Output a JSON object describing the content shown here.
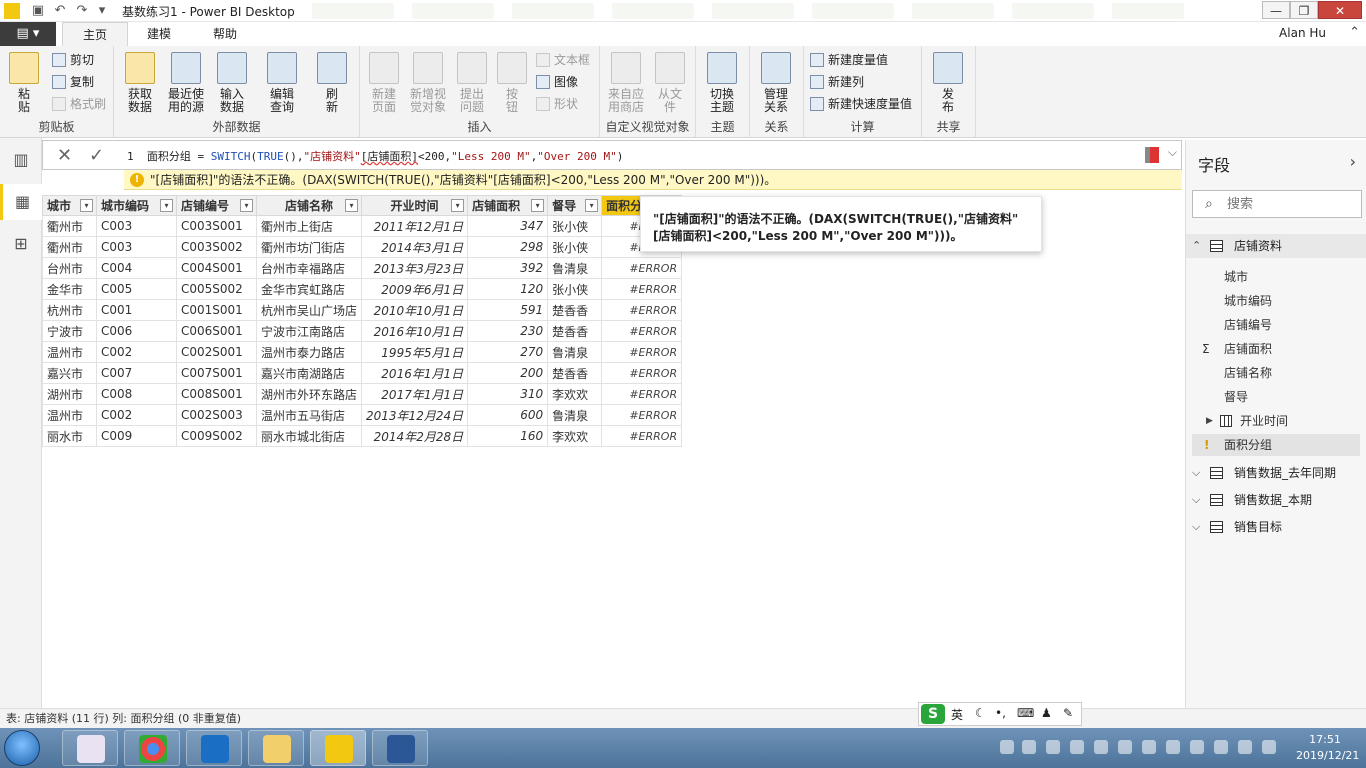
{
  "window": {
    "title": "基数练习1 - Power BI Desktop",
    "minimize": "—",
    "restore": "❐",
    "close": "✕"
  },
  "tabs": {
    "file": "▤ ▾",
    "items": [
      "主页",
      "建模",
      "帮助"
    ],
    "user": "Alan Hu"
  },
  "ribbon": {
    "clipboard": {
      "group": "剪贴板",
      "paste": [
        "粘",
        "贴"
      ],
      "cut": "剪切",
      "copy": "复制",
      "format_painter": "格式刷"
    },
    "external": {
      "group": "外部数据",
      "get_data": [
        "获取",
        "数据"
      ],
      "recent": [
        "最近使",
        "用的源"
      ],
      "enter": [
        "输入",
        "数据"
      ],
      "edit_queries": [
        "编辑",
        "查询"
      ],
      "refresh": [
        "刷",
        "新"
      ]
    },
    "insert": {
      "group": "插入",
      "new_page": [
        "新建",
        "页面"
      ],
      "new_visual": [
        "新增视",
        "觉对象"
      ],
      "ask": [
        "提出",
        "问题"
      ],
      "buttons": [
        "按",
        "钮"
      ],
      "textbox": "文本框",
      "image": "图像",
      "shapes": "形状"
    },
    "custom_visuals": {
      "group": "自定义视觉对象",
      "from_store": [
        "来自应",
        "用商店"
      ],
      "from_file": [
        "从文",
        "件"
      ]
    },
    "themes": {
      "group": "主题",
      "switch": [
        "切换",
        "主题"
      ]
    },
    "relationships": {
      "group": "关系",
      "manage": [
        "管理",
        "关系"
      ]
    },
    "calculations": {
      "group": "计算",
      "new_measure": "新建度量值",
      "new_column": "新建列",
      "quick_measure": "新建快速度量值"
    },
    "share": {
      "group": "共享",
      "publish": [
        "发",
        "布"
      ]
    }
  },
  "formula": {
    "line_no": "1",
    "name": "面积分组 = ",
    "func": "SWITCH",
    "open": "(",
    "true_fn": "TRUE",
    "parens": "(),",
    "table": "\"店铺资料\"",
    "col": "[店铺面积]",
    "op": "<200,",
    "s1": "\"Less 200 M\"",
    "comma": ",",
    "s2": "\"Over 200 M\"",
    "close": ")",
    "error": "\"[店铺面积]\"的语法不正确。(DAX(SWITCH(TRUE(),\"店铺资料\"[店铺面积]<200,\"Less 200 M\",\"Over 200 M\")))。"
  },
  "tooltip": "\"[店铺面积]\"的语法不正确。(DAX(SWITCH(TRUE(),\"店铺资料\"[店铺面积]<200,\"Less 200 M\",\"Over 200 M\")))。",
  "grid": {
    "headers": [
      "城市",
      "城市编码",
      "店铺编号",
      "店铺名称",
      "开业时间",
      "店铺面积",
      "督导",
      "面积分组"
    ],
    "rows": [
      [
        "衢州市",
        "C003",
        "C003S001",
        "衢州市上街店",
        "2011年12月1日",
        "347",
        "张小侠",
        "#ERROR"
      ],
      [
        "衢州市",
        "C003",
        "C003S002",
        "衢州市坊门街店",
        "2014年3月1日",
        "298",
        "张小侠",
        "#ERROR"
      ],
      [
        "台州市",
        "C004",
        "C004S001",
        "台州市幸福路店",
        "2013年3月23日",
        "392",
        "鲁清泉",
        "#ERROR"
      ],
      [
        "金华市",
        "C005",
        "C005S002",
        "金华市宾虹路店",
        "2009年6月1日",
        "120",
        "张小侠",
        "#ERROR"
      ],
      [
        "杭州市",
        "C001",
        "C001S001",
        "杭州市吴山广场店",
        "2010年10月1日",
        "591",
        "楚香香",
        "#ERROR"
      ],
      [
        "宁波市",
        "C006",
        "C006S001",
        "宁波市江南路店",
        "2016年10月1日",
        "230",
        "楚香香",
        "#ERROR"
      ],
      [
        "温州市",
        "C002",
        "C002S001",
        "温州市泰力路店",
        "1995年5月1日",
        "270",
        "鲁清泉",
        "#ERROR"
      ],
      [
        "嘉兴市",
        "C007",
        "C007S001",
        "嘉兴市南湖路店",
        "2016年1月1日",
        "200",
        "楚香香",
        "#ERROR"
      ],
      [
        "湖州市",
        "C008",
        "C008S001",
        "湖州市外环东路店",
        "2017年1月1日",
        "310",
        "李欢欢",
        "#ERROR"
      ],
      [
        "温州市",
        "C002",
        "C002S003",
        "温州市五马街店",
        "2013年12月24日",
        "600",
        "鲁清泉",
        "#ERROR"
      ],
      [
        "丽水市",
        "C009",
        "C009S002",
        "丽水市城北街店",
        "2014年2月28日",
        "160",
        "李欢欢",
        "#ERROR"
      ]
    ]
  },
  "fields": {
    "header": "字段",
    "search_placeholder": "搜索",
    "table_open": "店铺资料",
    "items": [
      "城市",
      "城市编码",
      "店铺编号",
      "店铺面积",
      "店铺名称",
      "督导",
      "开业时间",
      "面积分组"
    ],
    "tables": [
      "销售数据_去年同期",
      "销售数据_本期",
      "销售目标"
    ]
  },
  "status": "表: 店铺资料 (11 行) 列: 面积分组 (0 非重复值)",
  "ime": {
    "logo": "S",
    "lang": "英"
  },
  "clock": {
    "time": "17:51",
    "date": "2019/12/21"
  }
}
